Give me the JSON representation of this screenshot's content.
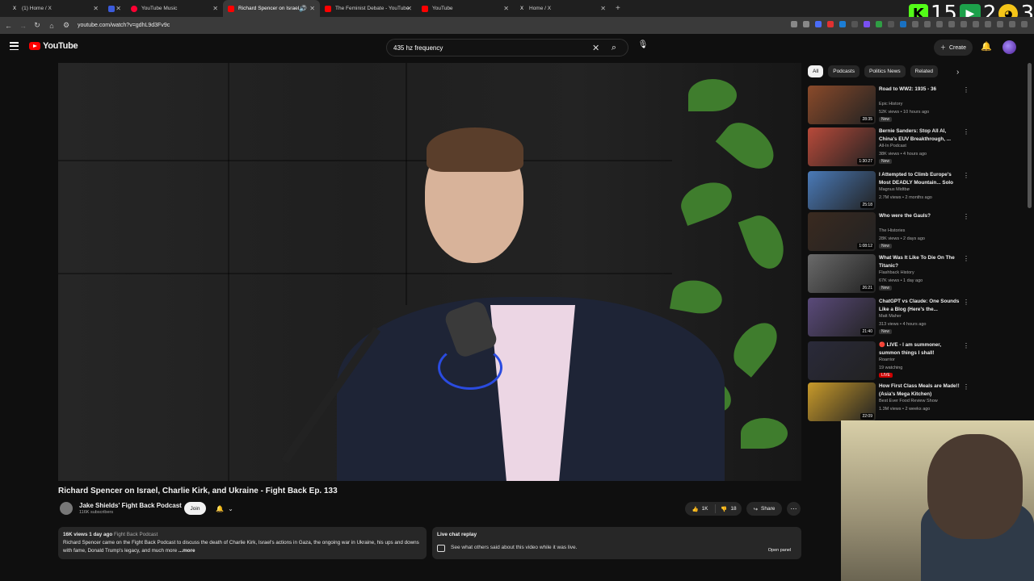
{
  "browser": {
    "tabs": [
      {
        "label": "(1) Home / X",
        "icon": "x-icon"
      },
      {
        "label": "",
        "icon": "mail-icon"
      },
      {
        "label": "YouTube Music",
        "icon": "youtube-music-icon"
      },
      {
        "label": "Richard Spencer on Israel, C",
        "icon": "youtube-icon",
        "active": true
      },
      {
        "label": "The Feminist Debate - YouTube",
        "icon": "youtube-icon"
      },
      {
        "label": "YouTube",
        "icon": "youtube-icon"
      },
      {
        "label": "Home / X",
        "icon": "x-icon"
      }
    ],
    "new_tab": "+",
    "url": "youtube.com/watch?v=gdhL9d3Fv9c",
    "overlay_counter": {
      "first": "15",
      "second": "2",
      "third": "3"
    }
  },
  "header": {
    "logo_text": "YouTube",
    "search_value": "435 hz frequency",
    "create_label": "Create"
  },
  "video": {
    "title": "Richard Spencer on Israel, Charlie Kirk, and Ukraine - Fight Back Ep. 133",
    "channel_name": "Jake Shields' Fight Back Podcast",
    "subscribers": "116K subscribers",
    "join_label": "Join",
    "likes": "1K",
    "dislikes": "18",
    "share_label": "Share"
  },
  "description": {
    "stats": "16K views  1 day ago",
    "tag_channel": "Fight Back Podcast",
    "text": "Richard Spencer came on the Fight Back Podcast to discuss the death of Charlie Kirk, Israel's actions in Gaza, the ongoing war in Ukraine, his ups and downs with fame, Donald Trump's legacy, and much more",
    "more_label": "...more"
  },
  "live_chat": {
    "title": "Live chat replay",
    "text": "See what others said about this video while it was live.",
    "open_label": "Open panel"
  },
  "chips": [
    {
      "label": "All",
      "active": true
    },
    {
      "label": "Podcasts"
    },
    {
      "label": "Politics News"
    },
    {
      "label": "Related"
    }
  ],
  "recommendations": [
    {
      "title": "Road to WW2: 1935 - 36",
      "channel": "Epic History",
      "meta": "52K views • 10 hours ago",
      "badge": "New",
      "duration": "28:35",
      "thumb_color": "#8a4a2a"
    },
    {
      "title": "Bernie Sanders: Stop All AI, China's EUV Breakthrough, ...",
      "channel": "All-In Podcast",
      "meta": "38K views • 4 hours ago",
      "badge": "New",
      "duration": "1:30:27",
      "thumb_color": "#b84a3a"
    },
    {
      "title": "I Attempted to Climb Europe's Most DEADLY Mountain... Solo",
      "channel": "Magnus Midtbø",
      "meta": "2.7M views • 2 months ago",
      "badge": "",
      "duration": "25:18",
      "thumb_color": "#4a7ab8"
    },
    {
      "title": "Who were the Gauls?",
      "channel": "The Histories",
      "meta": "28K views • 2 days ago",
      "badge": "New",
      "duration": "1:08:12",
      "thumb_color": "#3a2a20"
    },
    {
      "title": "What Was It Like To Die On The Titanic?",
      "channel": "Flashback History",
      "meta": "67K views • 1 day ago",
      "badge": "New",
      "duration": "26:21",
      "thumb_color": "#6a6a6a"
    },
    {
      "title": "ChatGPT vs Claude: One Sounds Like a Blog (Here's the...",
      "channel": "Matt Maher",
      "meta": "313 views • 4 hours ago",
      "badge": "New",
      "duration": "21:40",
      "thumb_color": "#5a4a7a"
    },
    {
      "title": "🔴 LIVE - I am summoner, summon things I shall!",
      "channel": "Roarrior",
      "meta": "19 watching",
      "badge": "LIVE",
      "duration": "",
      "thumb_color": "#2a2a3a"
    },
    {
      "title": "How First Class Meals are Made!! (Asia's Mega Kitchen)",
      "channel": "Best Ever Food Review Show",
      "meta": "1.3M views • 2 weeks ago",
      "badge": "",
      "duration": "22:09",
      "thumb_color": "#c89a2a"
    }
  ]
}
